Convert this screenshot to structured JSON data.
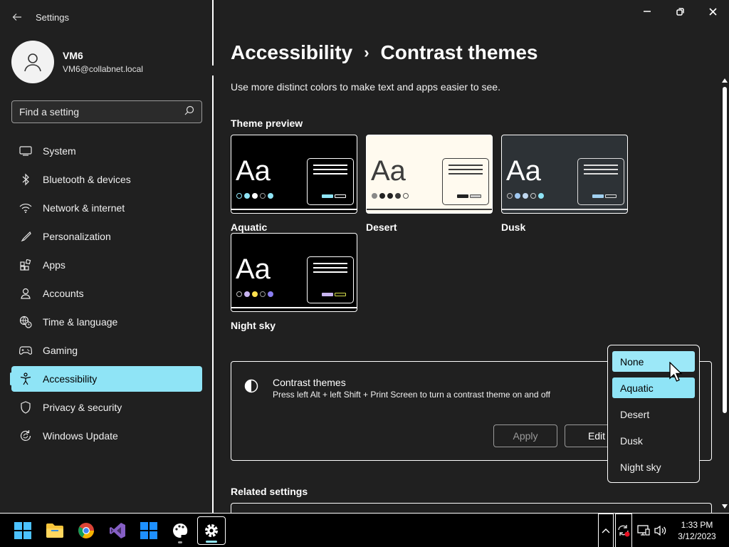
{
  "app": {
    "title": "Settings"
  },
  "profile": {
    "name": "VM6",
    "email": "VM6@collabnet.local"
  },
  "search": {
    "placeholder": "Find a setting"
  },
  "sidebar": {
    "items": [
      {
        "label": "System",
        "icon": "monitor-icon"
      },
      {
        "label": "Bluetooth & devices",
        "icon": "bluetooth-icon"
      },
      {
        "label": "Network & internet",
        "icon": "wifi-icon"
      },
      {
        "label": "Personalization",
        "icon": "brush-icon"
      },
      {
        "label": "Apps",
        "icon": "apps-icon"
      },
      {
        "label": "Accounts",
        "icon": "person-icon"
      },
      {
        "label": "Time & language",
        "icon": "globe-clock-icon"
      },
      {
        "label": "Gaming",
        "icon": "gamepad-icon"
      },
      {
        "label": "Accessibility",
        "icon": "accessibility-icon",
        "active": true
      },
      {
        "label": "Privacy & security",
        "icon": "shield-icon"
      },
      {
        "label": "Windows Update",
        "icon": "update-icon"
      }
    ]
  },
  "main": {
    "breadcrumb": {
      "parent": "Accessibility",
      "separator": "›",
      "current": "Contrast themes"
    },
    "subtitle": "Use more distinct colors to make text and apps easier to see.",
    "preview_heading": "Theme preview",
    "themes": [
      {
        "name": "Aquatic",
        "sample": "Aa"
      },
      {
        "name": "Desert",
        "sample": "Aa"
      },
      {
        "name": "Dusk",
        "sample": "Aa"
      },
      {
        "name": "Night sky",
        "sample": "Aa"
      }
    ],
    "contrast_card": {
      "title": "Contrast themes",
      "description": "Press left Alt + left Shift + Print Screen to turn a contrast theme on and off",
      "apply_label": "Apply",
      "edit_label": "Edit"
    },
    "related_heading": "Related settings"
  },
  "dropdown": {
    "options": [
      "None",
      "Aquatic",
      "Desert",
      "Dusk",
      "Night sky"
    ],
    "hovered": "None",
    "selected": "Aquatic"
  },
  "taskbar": {
    "time": "1:33 PM",
    "date": "3/12/2023"
  },
  "colors": {
    "accent": "#8fe4f6",
    "background": "#202020",
    "border": "#ffffff"
  }
}
